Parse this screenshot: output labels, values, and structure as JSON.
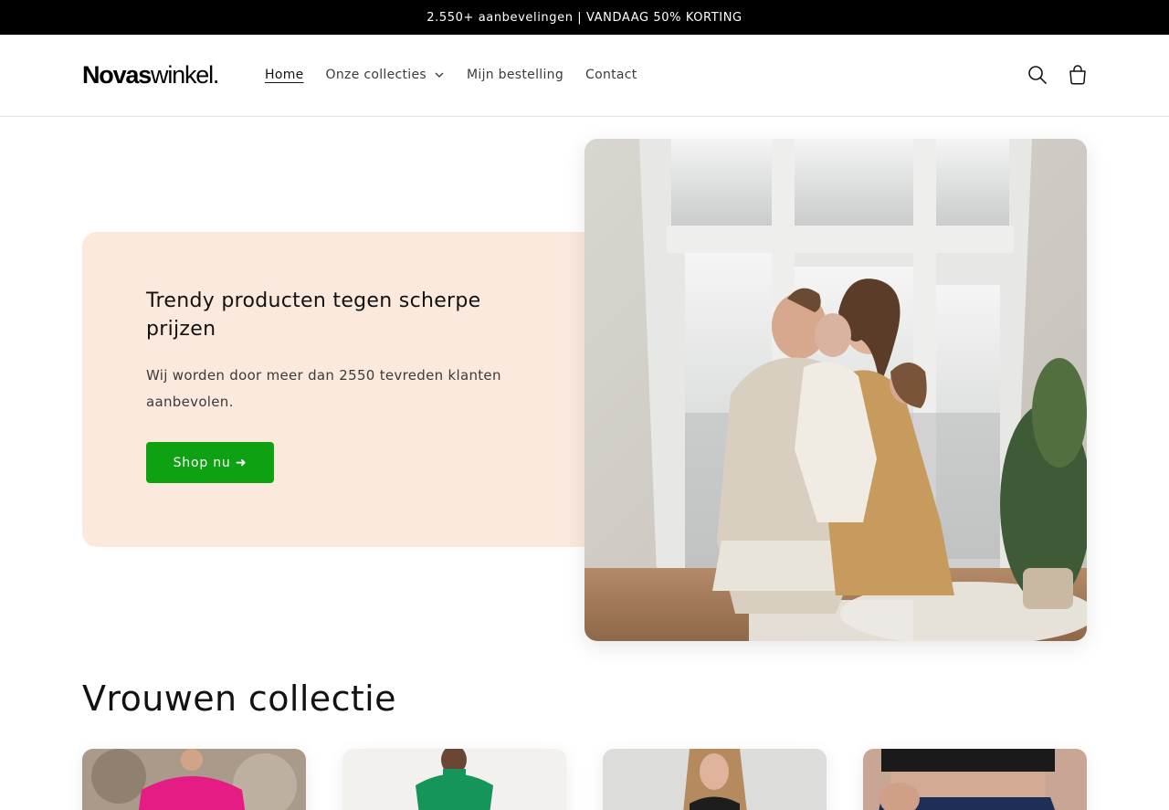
{
  "announcement": {
    "text": "2.550+ aanbevelingen | VANDAAG 50% KORTING"
  },
  "header": {
    "logo": {
      "bold": "Novas",
      "light": "winkel."
    },
    "nav": [
      {
        "label": "Home",
        "active": true
      },
      {
        "label": "Onze collecties",
        "has_dropdown": true
      },
      {
        "label": "Mijn bestelling"
      },
      {
        "label": "Contact"
      }
    ],
    "icons": [
      "search-icon",
      "cart-icon"
    ]
  },
  "hero": {
    "title": "Trendy producten tegen scherpe prijzen",
    "subtitle": "Wij worden door meer dan 2550 tevreden klanten aanbevolen.",
    "button_label": "Shop nu ➜",
    "colors": {
      "card_bg": "#fbe9de",
      "button_bg": "#0ea212"
    }
  },
  "collection": {
    "title": "Vrouwen collectie"
  }
}
